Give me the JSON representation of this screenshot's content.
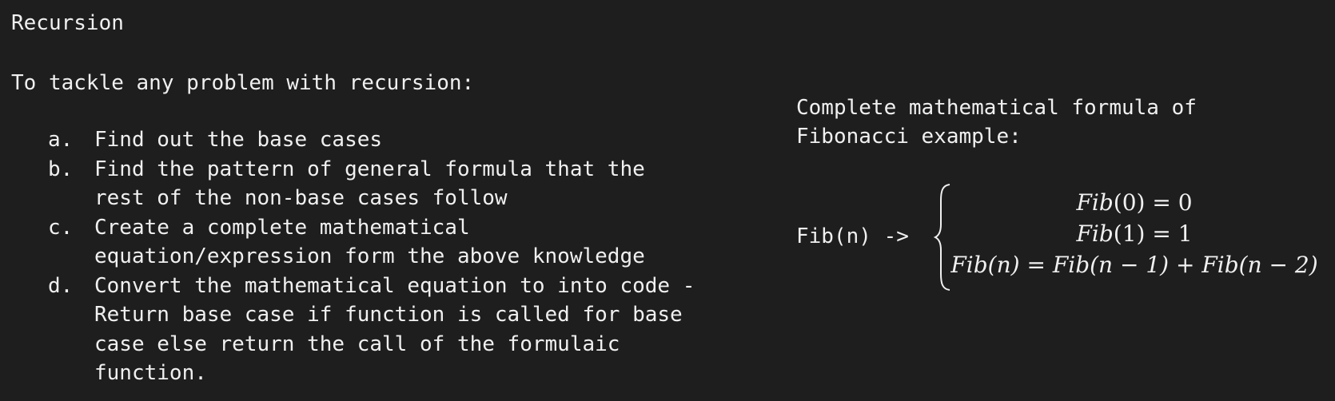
{
  "title": "Recursion",
  "intro": "To tackle any problem with recursion:",
  "steps": [
    {
      "marker": "a.",
      "lines": [
        "Find out the base cases"
      ]
    },
    {
      "marker": "b.",
      "lines": [
        "Find the pattern of general formula that the",
        "rest of the non-base cases follow"
      ]
    },
    {
      "marker": "c.",
      "lines": [
        "Create a complete mathematical",
        "equation/expression form the above knowledge"
      ]
    },
    {
      "marker": "d.",
      "lines": [
        "Convert the mathematical equation to into code -",
        "Return base case if function is called for base",
        "case else return the call of the formulaic",
        "function."
      ]
    }
  ],
  "right": {
    "heading": [
      "Complete mathematical formula of",
      "Fibonacci example:"
    ],
    "label": "Fib(n) ->",
    "cases": [
      {
        "lhs_fn": "Fib",
        "lhs_arg": "(0)",
        "rhs": " = 0"
      },
      {
        "lhs_fn": "Fib",
        "lhs_arg": "(1)",
        "rhs": " = 1"
      },
      {
        "lhs_fn": "Fib(n)",
        "lhs_arg": "",
        "rhs": " = Fib(n − 1) + Fib(n − 2)"
      }
    ]
  },
  "colors": {
    "background": "#1e1e1e",
    "text": "#f0f0f0"
  }
}
